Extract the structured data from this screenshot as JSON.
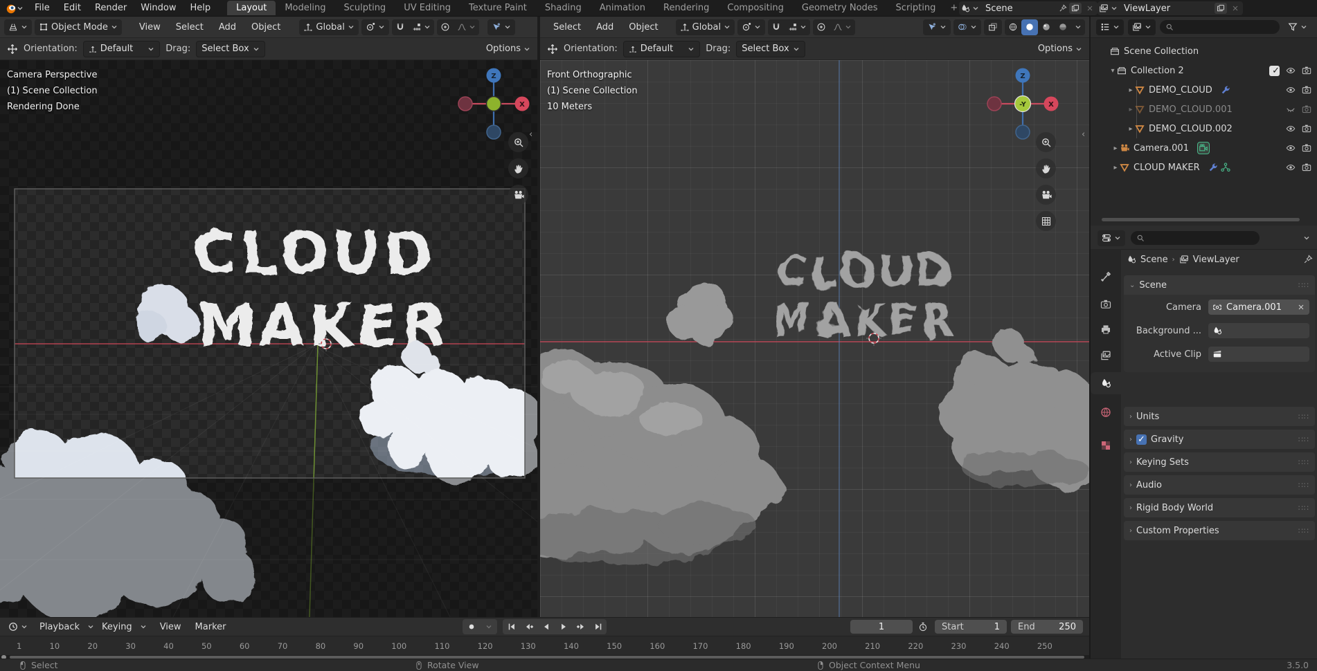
{
  "topbar": {
    "menus": [
      "File",
      "Edit",
      "Render",
      "Window",
      "Help"
    ],
    "active_tab": "Layout",
    "tabs": [
      "Modeling",
      "Sculpting",
      "UV Editing",
      "Texture Paint",
      "Shading",
      "Animation",
      "Rendering",
      "Compositing",
      "Geometry Nodes",
      "Scripting"
    ],
    "add_tab": "+",
    "scene": "Scene",
    "view_layer": "ViewLayer"
  },
  "viewports": {
    "left": {
      "header": {
        "mode": "Object Mode",
        "menus": [
          "View",
          "Select",
          "Add",
          "Object"
        ],
        "orientation": "Global"
      },
      "overlay": [
        "Camera Perspective",
        "(1) Scene Collection",
        "Rendering Done"
      ],
      "gizmo": {
        "top": "Z",
        "right": "X"
      },
      "text_line1": "CLOUD",
      "text_line2": "MAKER"
    },
    "right": {
      "header": {
        "menus": [
          "Select",
          "Add",
          "Object"
        ],
        "orientation": "Global"
      },
      "overlay": [
        "Front Orthographic",
        "(1) Scene Collection",
        "10 Meters"
      ],
      "gizmo": {
        "top": "Z",
        "right": "X",
        "center": "-Y"
      },
      "text_line1": "CLOUD",
      "text_line2": "MAKER"
    }
  },
  "tool_settings": {
    "orientation_label": "Orientation:",
    "orientation_value": "Default",
    "drag_label": "Drag:",
    "drag_value": "Select Box",
    "options": "Options"
  },
  "outliner": {
    "items": [
      {
        "label": "Scene Collection"
      },
      {
        "label": "Collection 2"
      },
      {
        "label": "DEMO_CLOUD"
      },
      {
        "label": "DEMO_CLOUD.001"
      },
      {
        "label": "DEMO_CLOUD.002"
      },
      {
        "label": "Camera.001"
      },
      {
        "label": "CLOUD MAKER"
      }
    ]
  },
  "properties": {
    "breadcrumb": {
      "scene": "Scene",
      "view_layer": "ViewLayer",
      "sep": "›"
    },
    "scene_panel": {
      "title": "Scene",
      "camera_label": "Camera",
      "camera_value": "Camera.001",
      "background_label": "Background ...",
      "active_clip_label": "Active Clip"
    },
    "panels": [
      "Units",
      "Gravity",
      "Keying Sets",
      "Audio",
      "Rigid Body World",
      "Custom Properties"
    ]
  },
  "timeline": {
    "playback": "Playback",
    "keying": "Keying",
    "view": "View",
    "marker": "Marker",
    "current_frame": "1",
    "start_label": "Start",
    "start_value": "1",
    "end_label": "End",
    "end_value": "250",
    "ticks": [
      "1",
      "10",
      "20",
      "30",
      "40",
      "50",
      "60",
      "70",
      "80",
      "90",
      "100",
      "110",
      "120",
      "130",
      "140",
      "150",
      "160",
      "170",
      "180",
      "190",
      "200",
      "210",
      "220",
      "230",
      "240",
      "250"
    ]
  },
  "statusbar": {
    "select": "Select",
    "rotate": "Rotate View",
    "context": "Object Context Menu",
    "version": "3.5.0"
  },
  "colors": {
    "accent": "#4772b3",
    "axis_x": "#cc4a5c",
    "axis_y": "#7aa335",
    "axis_z": "#3f6fae",
    "object_orange": "#cf8844",
    "modifier_blue": "#5f7fd0",
    "nodes_green": "#49b88a"
  }
}
